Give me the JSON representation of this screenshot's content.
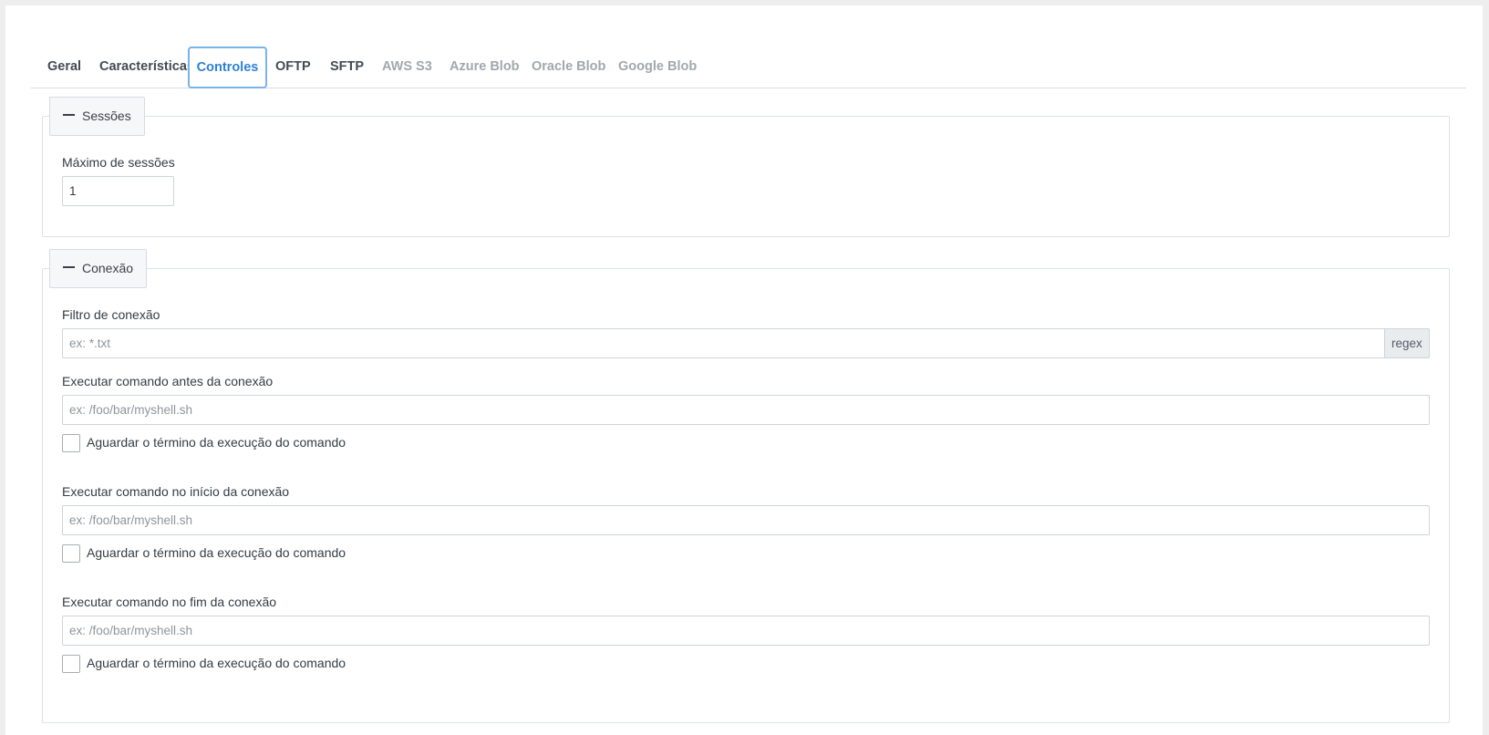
{
  "tabs": [
    {
      "label": "Geral",
      "state": "normal"
    },
    {
      "label": "Características",
      "state": "normal"
    },
    {
      "label": "Controles",
      "state": "active"
    },
    {
      "label": "OFTP",
      "state": "normal"
    },
    {
      "label": "SFTP",
      "state": "normal"
    },
    {
      "label": "AWS S3",
      "state": "disabled"
    },
    {
      "label": "Azure Blob",
      "state": "disabled"
    },
    {
      "label": "Oracle Blob",
      "state": "disabled"
    },
    {
      "label": "Google Blob",
      "state": "disabled"
    }
  ],
  "sessions": {
    "title": "Sessões",
    "collapse_icon": "minus-icon",
    "max_sessions_label": "Máximo de sessões",
    "max_sessions_value": "1"
  },
  "connection": {
    "title": "Conexão",
    "collapse_icon": "minus-icon",
    "filter_label": "Filtro de conexão",
    "filter_placeholder": "ex: *.txt",
    "filter_value": "",
    "filter_addon": "regex",
    "before_label": "Executar comando antes da conexão",
    "before_placeholder": "ex: /foo/bar/myshell.sh",
    "before_wait_label": "Aguardar o término da execução do comando",
    "before_wait_checked": false,
    "start_label": "Executar comando no início da conexão",
    "start_placeholder": "ex: /foo/bar/myshell.sh",
    "start_wait_label": "Aguardar o término da execução do comando",
    "start_wait_checked": false,
    "end_label": "Executar comando no fim da conexão",
    "end_placeholder": "ex: /foo/bar/myshell.sh",
    "end_wait_label": "Aguardar o término da execução do comando",
    "end_wait_checked": false
  },
  "colors": {
    "accent": "#2f80d6",
    "active_tab_border": "#79b3ea",
    "disabled_tab": "#a2a7ad"
  }
}
